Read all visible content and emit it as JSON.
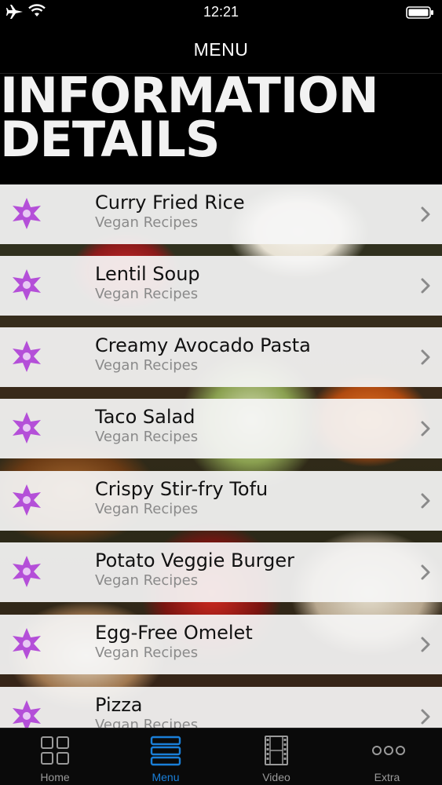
{
  "status_bar": {
    "time": "12:21"
  },
  "nav": {
    "title": "MENU"
  },
  "header": {
    "line1": "INFORMATION",
    "line2": "DETAILS"
  },
  "list": [
    {
      "title": "Curry Fried Rice",
      "subtitle": "Vegan Recipes"
    },
    {
      "title": "Lentil Soup",
      "subtitle": "Vegan Recipes"
    },
    {
      "title": "Creamy Avocado Pasta",
      "subtitle": "Vegan Recipes"
    },
    {
      "title": "Taco Salad",
      "subtitle": "Vegan Recipes"
    },
    {
      "title": "Crispy Stir-fry Tofu",
      "subtitle": "Vegan Recipes"
    },
    {
      "title": "Potato Veggie Burger",
      "subtitle": "Vegan Recipes"
    },
    {
      "title": "Egg-Free Omelet",
      "subtitle": "Vegan Recipes"
    },
    {
      "title": "Pizza",
      "subtitle": "Vegan Recipes"
    }
  ],
  "tabs": [
    {
      "label": "Home",
      "icon": "grid-icon"
    },
    {
      "label": "Menu",
      "icon": "list-icon",
      "active": true
    },
    {
      "label": "Video",
      "icon": "film-icon"
    },
    {
      "label": "Extra",
      "icon": "more-icon"
    }
  ],
  "colors": {
    "accent": "#1a7fd8",
    "star": "#b44fd8"
  }
}
